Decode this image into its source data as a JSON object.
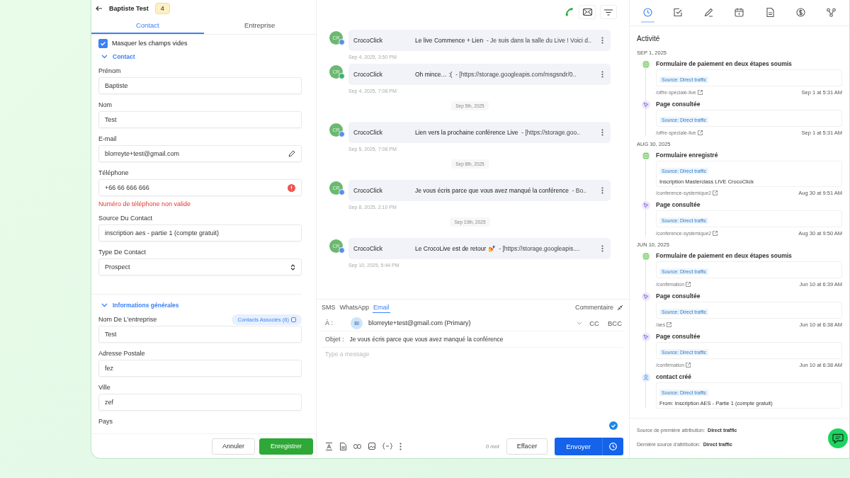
{
  "header": {
    "name": "Baptiste Test",
    "badge": "4"
  },
  "tabs": [
    {
      "label": "Contact",
      "selected": true
    },
    {
      "label": "Entreprise",
      "selected": false
    }
  ],
  "hide_empty": {
    "label": "Masquer les champs vides",
    "checked": true
  },
  "sections": [
    {
      "title": "Contact",
      "expanded": true,
      "fields": [
        {
          "label": "Prénom",
          "value": "Baptiste",
          "kind": "text"
        },
        {
          "label": "Nom",
          "value": "Test",
          "kind": "text"
        },
        {
          "label": "E-mail",
          "value": "blorreyte+test@gmail.com",
          "kind": "editable"
        },
        {
          "label": "Téléphone",
          "value": "+66 66 666 666",
          "kind": "invalid",
          "error": "Numéro de téléphone non valide"
        },
        {
          "label": "Source Du Contact",
          "value": "inscription aes - partie 1 (compte gratuit)",
          "kind": "text"
        },
        {
          "label": "Type De Contact",
          "value": "Prospect",
          "kind": "select"
        }
      ]
    },
    {
      "title": "Informations générales",
      "expanded": true,
      "fields": [
        {
          "label": "Nom De L'entreprise",
          "value": "Test",
          "kind": "text",
          "link": "Contacts Associés (6)"
        },
        {
          "label": "Adresse Postale",
          "value": "fez",
          "kind": "text"
        },
        {
          "label": "Ville",
          "value": "zef",
          "kind": "text"
        },
        {
          "label": "Pays"
        }
      ]
    }
  ],
  "footer": {
    "cancel": "Annuler",
    "save": "Enregistrer"
  },
  "timeline": [
    {
      "kind": "message",
      "avatar": "CR",
      "color": "#5b8def",
      "sender": "CrocoClick",
      "subject": "Le live Commence + Lien",
      "preview": "-  Je suis dans la salle du Live ! Voici d..",
      "time": "Sep 4, 2025, 3:50 PM"
    },
    {
      "kind": "message",
      "avatar": "CR",
      "color": "#3cb371",
      "sender": "CrocoClick",
      "subject": "Oh mince… :(",
      "preview": "-  [https://storage.googleapis.com/msgsndr/0..",
      "time": "Sep 4, 2025, 7:08 PM"
    },
    {
      "kind": "date",
      "label": "Sep 5th, 2025"
    },
    {
      "kind": "message",
      "avatar": "CR",
      "color": "#5b8def",
      "sender": "CrocoClick",
      "subject": "Lien vers la prochaine conférence Live",
      "preview": "-  [https://storage.goo..",
      "time": "Sep 5, 2025, 7:08 PM"
    },
    {
      "kind": "date",
      "label": "Sep 8th, 2025"
    },
    {
      "kind": "message",
      "avatar": "CR",
      "color": "#5b8def",
      "sender": "CrocoClick",
      "subject": "Je vous écris parce que vous avez manqué la conférence",
      "preview": "-  Bo..",
      "time": "Sep 8, 2025, 2:10 PM"
    },
    {
      "kind": "date",
      "label": "Sep 10th, 2025"
    },
    {
      "kind": "message",
      "avatar": "CR",
      "color": "#5b8def",
      "sender": "CrocoClick",
      "subject": "Le CrocoLive est de retour 💅",
      "preview": "-  [https://storage.googleapis....",
      "time": "Sep 10, 2025, 5:44 PM"
    }
  ],
  "composer": {
    "channels": [
      {
        "label": "SMS",
        "selected": false
      },
      {
        "label": "WhatsApp",
        "selected": false
      },
      {
        "label": "Email",
        "selected": true
      }
    ],
    "comment": "Commentaire",
    "to_label": "À :",
    "recipient_avatar": "Bl",
    "recipient": "blorreyte+test@gmail.com (Primary)",
    "cc": "CC",
    "bcc": "BCC",
    "subject_label": "Objet :",
    "subject": "Je vous écris parce que vous avez manqué la conférence",
    "placeholder": "Type a message",
    "word_count": "0 mot",
    "clear": "Effacer",
    "send": "Envoyer"
  },
  "side_tabs": [
    {
      "kind": "activity",
      "selected": true
    },
    {
      "kind": "tasks",
      "selected": false
    },
    {
      "kind": "notes",
      "selected": false
    },
    {
      "kind": "calendar",
      "selected": false
    },
    {
      "kind": "documents",
      "selected": false
    },
    {
      "kind": "payments",
      "selected": false
    },
    {
      "kind": "workflows",
      "selected": false
    }
  ],
  "activity": {
    "title": "Activité",
    "groups": [
      {
        "date": "SEP 1, 2025",
        "events": [
          {
            "kind": "form",
            "title": "Formulaire de paiement en deux étapes soumis",
            "source": "Source: Direct traffic",
            "path": "/offre-speciale-live",
            "time": "Sep 1 at 5:31 AM"
          },
          {
            "kind": "page",
            "title": "Page consultée",
            "source": "Source: Direct traffic",
            "path": "/offre-speciale-live",
            "time": "Sep 1 at 5:31 AM"
          }
        ]
      },
      {
        "date": "AUG 30, 2025",
        "events": [
          {
            "kind": "form",
            "title": "Formulaire enregistré",
            "source": "Source: Direct traffic",
            "detail": "Inscription Masterclass LIVE CrocoClick",
            "path": "/conference-systemique2",
            "time": "Aug 30 at 9:51 AM"
          },
          {
            "kind": "page",
            "title": "Page consultée",
            "source": "Source: Direct traffic",
            "path": "/conference-systemique2",
            "time": "Aug 30 at 9:50 AM"
          }
        ]
      },
      {
        "date": "JUN 10, 2025",
        "events": [
          {
            "kind": "form",
            "title": "Formulaire de paiement en deux étapes soumis",
            "source": "Source: Direct traffic",
            "path": "/confirmation",
            "time": "Jun 10 at 6:39 AM"
          },
          {
            "kind": "page",
            "title": "Page consultée",
            "source": "Source: Direct traffic",
            "path": "/aes",
            "time": "Jun 10 at 6:38 AM"
          },
          {
            "kind": "page",
            "title": "Page consultée",
            "source": "Source: Direct traffic",
            "path": "/confirmation",
            "time": "Jun 10 at 6:38 AM"
          },
          {
            "kind": "contact",
            "title": "contact créé",
            "source": "Source: Direct traffic",
            "detail": "From: Inscription AES - Partie 1 (compte gratuit)"
          }
        ]
      }
    ]
  },
  "attribution": [
    {
      "label": "Source de première attribution:",
      "value": "Direct traffic"
    },
    {
      "label": "Dernière source d'attribution:",
      "value": "Direct traffic"
    }
  ]
}
